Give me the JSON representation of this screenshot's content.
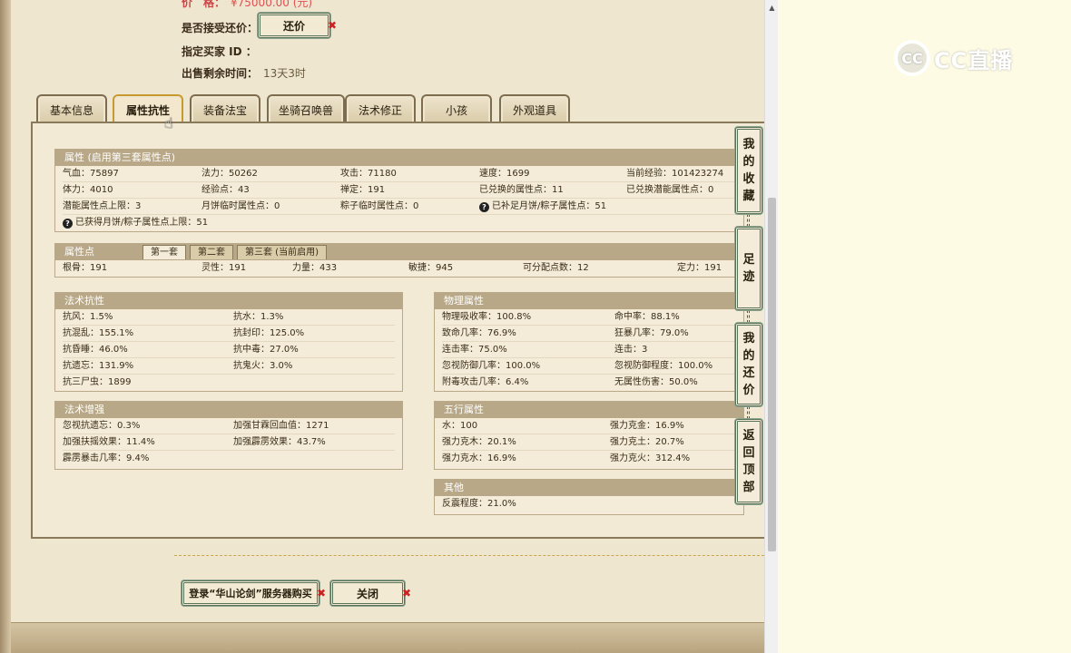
{
  "info": {
    "price_label": "价　格：",
    "price_value": "¥75000.00 (元)",
    "counter_label": "是否接受还价：",
    "counter_button": "还价",
    "buyer_label": "指定买家 ID ：",
    "time_label": "出售剩余时间：",
    "time_value": "13天3时"
  },
  "tabs": [
    "基本信息",
    "属性抗性",
    "装备法宝",
    "坐骑召唤兽",
    "法术修正",
    "小孩",
    "外观道具"
  ],
  "attributes": {
    "title": "属性 (启用第三套属性点)",
    "rows": [
      [
        "气血：75897",
        "法力：50262",
        "攻击：71180",
        "速度：1699",
        "当前经验：101423274"
      ],
      [
        "体力：4010",
        "经验点：43",
        "禅定：191",
        "已兑换的属性点：11",
        "已兑换潜能属性点：0"
      ],
      [
        "潜能属性点上限：3",
        "月饼临时属性点：0",
        "粽子临时属性点：0",
        "已补足月饼/粽子属性点：51",
        ""
      ],
      [
        "已获得月饼/粽子属性点上限：51",
        "",
        "",
        "",
        ""
      ]
    ]
  },
  "points": {
    "title": "属性点",
    "subtabs": [
      "第一套",
      "第二套",
      "第三套 (当前启用)"
    ],
    "row": [
      "根骨：191",
      "灵性：191",
      "力量：433",
      "敏捷：945",
      "可分配点数：12",
      "定力：191"
    ]
  },
  "magic_resist": {
    "title": "法术抗性",
    "rows": [
      [
        "抗风：1.5%",
        "抗水：1.3%"
      ],
      [
        "抗混乱：155.1%",
        "抗封印：125.0%"
      ],
      [
        "抗昏睡：46.0%",
        "抗中毒：27.0%"
      ],
      [
        "抗遗忘：131.9%",
        "抗鬼火：3.0%"
      ],
      [
        "抗三尸虫：1899",
        ""
      ]
    ]
  },
  "magic_boost": {
    "title": "法术增强",
    "rows": [
      [
        "忽视抗遗忘：0.3%",
        "加强甘霖回血值：1271"
      ],
      [
        "加强扶摇效果：11.4%",
        "加强霹雳效果：43.7%"
      ],
      [
        "霹雳暴击几率：9.4%",
        ""
      ]
    ]
  },
  "physical": {
    "title": "物理属性",
    "rows": [
      [
        "物理吸收率：100.8%",
        "命中率：88.1%"
      ],
      [
        "致命几率：76.9%",
        "狂暴几率：79.0%"
      ],
      [
        "连击率：75.0%",
        "连击：3"
      ],
      [
        "忽视防御几率：100.0%",
        "忽视防御程度：100.0%"
      ],
      [
        "附毒攻击几率：6.4%",
        "无属性伤害：50.0%"
      ]
    ]
  },
  "five_elements": {
    "title": "五行属性",
    "rows": [
      [
        "水：100",
        "强力克金：16.9%"
      ],
      [
        "强力克木：20.1%",
        "强力克土：20.7%"
      ],
      [
        "强力克水：16.9%",
        "强力克火：312.4%"
      ]
    ]
  },
  "other": {
    "title": "其他",
    "rows": [
      [
        "反震程度：21.0%",
        ""
      ]
    ]
  },
  "side": {
    "favorites": [
      "我",
      "的",
      "收",
      "藏"
    ],
    "footprint": [
      "足",
      "迹"
    ],
    "my_counter": [
      "我",
      "的",
      "还",
      "价"
    ],
    "back_top": [
      "返",
      "回",
      "顶",
      "部"
    ]
  },
  "buttons": {
    "login": "登录“华山论剑”服务器购买",
    "close": "关闭"
  },
  "logo": {
    "mark": "CC",
    "text": "CC直播"
  },
  "colors": {
    "tab_active_border": "#c89a2e",
    "section_header": "#b8a887",
    "button_border": "#59735a",
    "close_mark": "#cc2222"
  }
}
